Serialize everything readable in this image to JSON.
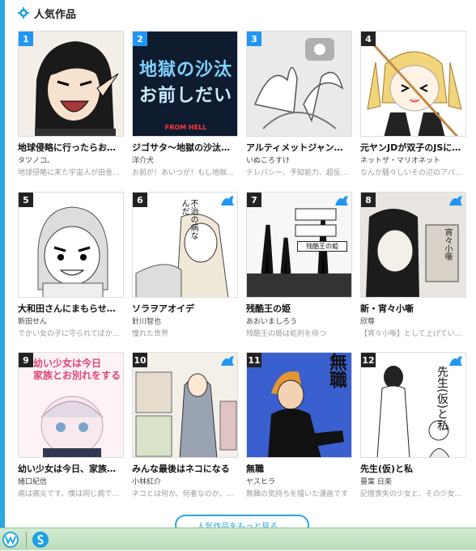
{
  "section": {
    "title": "人気作品"
  },
  "works": [
    {
      "rank": "1",
      "title": "地球侵略に行ったらお…",
      "author": "タツノコ。",
      "desc": "地球侵略に来た宇宙人が田舎…"
    },
    {
      "rank": "2",
      "title": "ジゴサタ〜地獄の沙汰…",
      "author": "洋介犬",
      "desc": "お前が！あいつが！もし地獄…"
    },
    {
      "rank": "3",
      "title": "アルティメットジャン…",
      "author": "いぬころすけ",
      "desc": "テレパシー、予知能力、超反…"
    },
    {
      "rank": "4",
      "title": "元ヤンJDが双子のJSに…",
      "author": "ネットザ・マリオネット",
      "desc": "なんか騒々しいその辺のアパ…"
    },
    {
      "rank": "5",
      "title": "大和田さんにまもらせ…",
      "author": "新田せん",
      "desc": "でかい女の子に守られてばか…"
    },
    {
      "rank": "6",
      "title": "ソラヲアオイデ",
      "author": "針川智也",
      "desc": "憧れた世界"
    },
    {
      "rank": "7",
      "title": "残酷王の姫",
      "author": "あおいましろう",
      "desc": "残酷王の姫は処刑を待つ"
    },
    {
      "rank": "8",
      "title": "新・宵々小噺",
      "author": "欣尊",
      "desc": "【宵々小噺】として上げてい…"
    },
    {
      "rank": "9",
      "title": "幼い少女は今日、家族…",
      "author": "緒口紀信",
      "desc": "病は病炎です。僕は同じ病で…"
    },
    {
      "rank": "10",
      "title": "みんな最後はネコになる",
      "author": "小林紅介",
      "desc": "ネコとは何か。何者なのか。…"
    },
    {
      "rank": "11",
      "title": "無職",
      "author": "ヤスヒラ",
      "desc": "無職の気持ちを描いた漫画です"
    },
    {
      "rank": "12",
      "title": "先生(仮)と私",
      "author": "蔓葉 日楽",
      "desc": "記憶喪失の少女と、その少女…"
    }
  ],
  "covers": {
    "c2_lines": [
      "地獄の沙汰",
      "お前しだい"
    ],
    "c2_sub": "FROM HELL",
    "c6_bubble": "不治の病なんだ",
    "c7_bubble": "残酷王の姫",
    "c8_text": "宵々小噺",
    "c9_lines": [
      "幼い少女は今日",
      "家族とお別れをする"
    ],
    "c11_text": "無職",
    "c12_text": "先生(仮)と私"
  },
  "more_button": {
    "label": "人気作品をもっと見る ⌄"
  },
  "colors": {
    "accent": "#2aa7e0",
    "rank_badge": "#2196f3"
  },
  "taskbar": {
    "icons": [
      "w-icon",
      "skype-icon"
    ]
  }
}
